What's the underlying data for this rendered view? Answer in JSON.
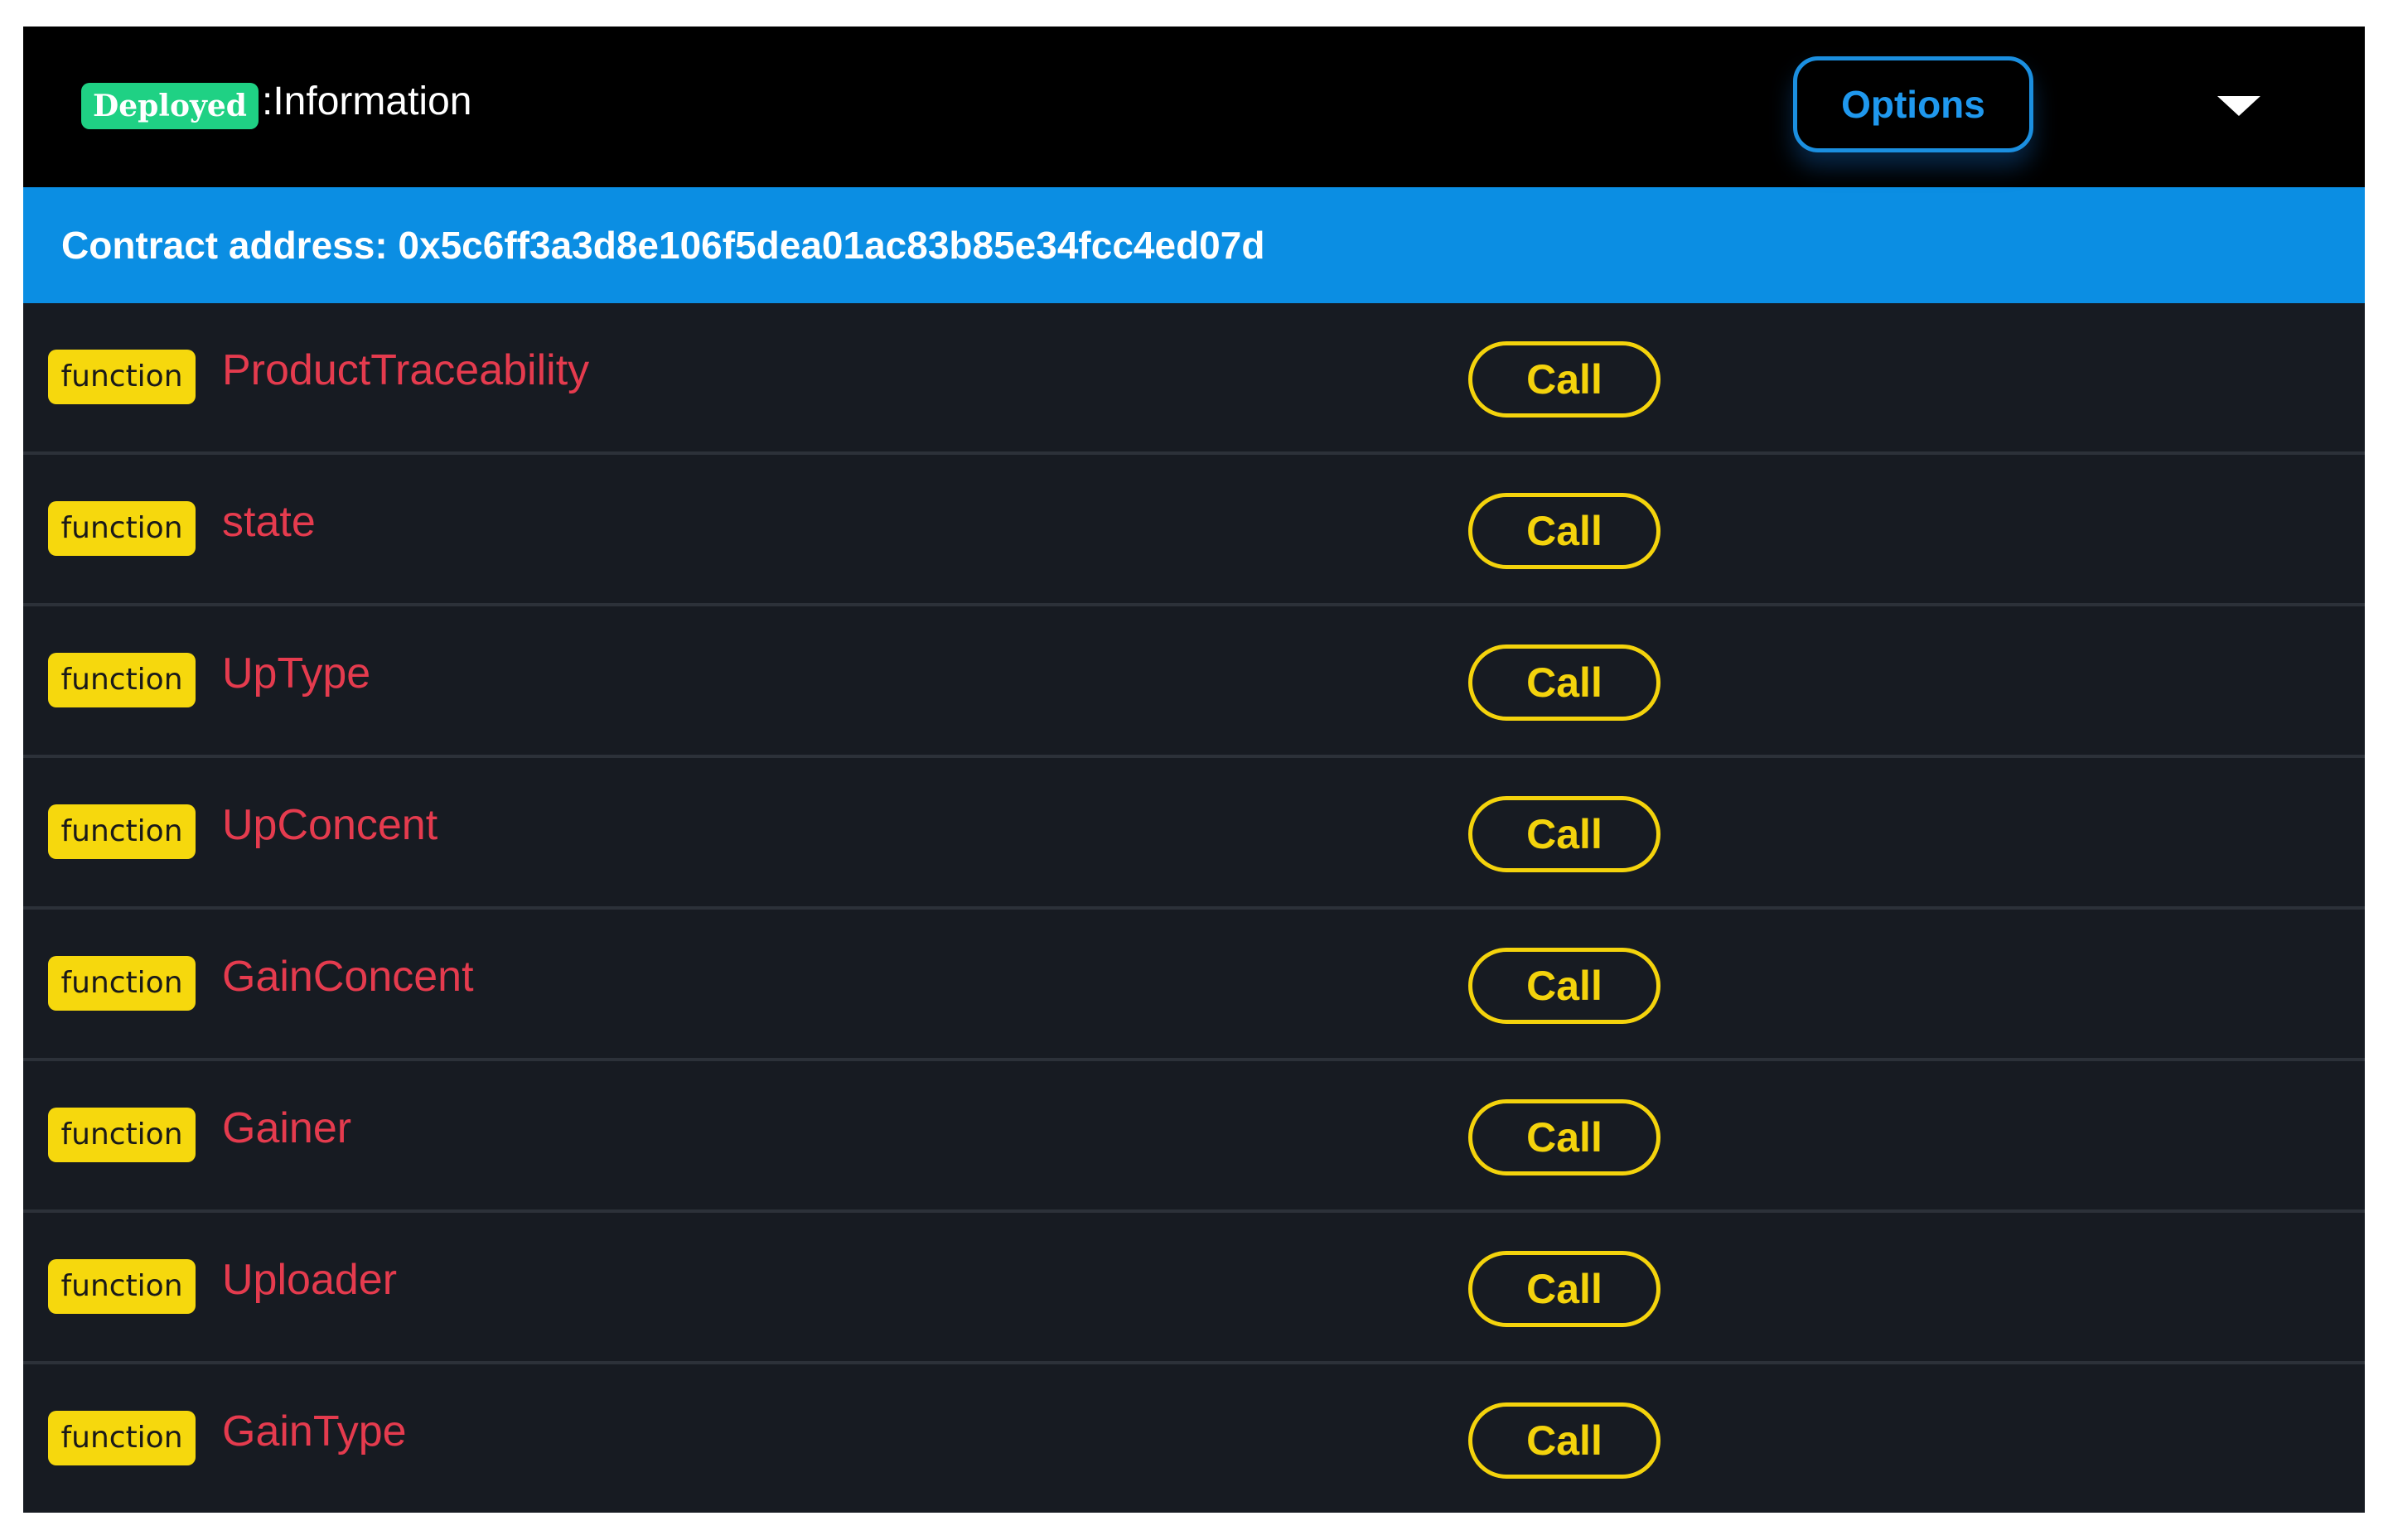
{
  "header": {
    "status_badge": "Deployed",
    "title": ":Information",
    "options_label": "Options",
    "expand_icon": "chevron-down-icon"
  },
  "contract": {
    "address_text": "Contract address: 0x5c6ff3a3d8e106f5dea01ac83b85e34fcc4ed07d"
  },
  "functions": [
    {
      "type_label": "function",
      "name": "ProductTraceability",
      "action_label": "Call"
    },
    {
      "type_label": "function",
      "name": "state",
      "action_label": "Call"
    },
    {
      "type_label": "function",
      "name": "UpType",
      "action_label": "Call"
    },
    {
      "type_label": "function",
      "name": "UpConcent",
      "action_label": "Call"
    },
    {
      "type_label": "function",
      "name": "GainConcent",
      "action_label": "Call"
    },
    {
      "type_label": "function",
      "name": "Gainer",
      "action_label": "Call"
    },
    {
      "type_label": "function",
      "name": "Uploader",
      "action_label": "Call"
    },
    {
      "type_label": "function",
      "name": "GainType",
      "action_label": "Call"
    }
  ],
  "colors": {
    "header_bg": "#000000",
    "address_bar_bg": "#0b8ee3",
    "panel_bg": "#171b22",
    "deployed_badge": "#1fd184",
    "function_badge": "#f6d80d",
    "function_name": "#e53b4e",
    "call_button": "#f4d30c",
    "options_button": "#1b8fe0"
  }
}
